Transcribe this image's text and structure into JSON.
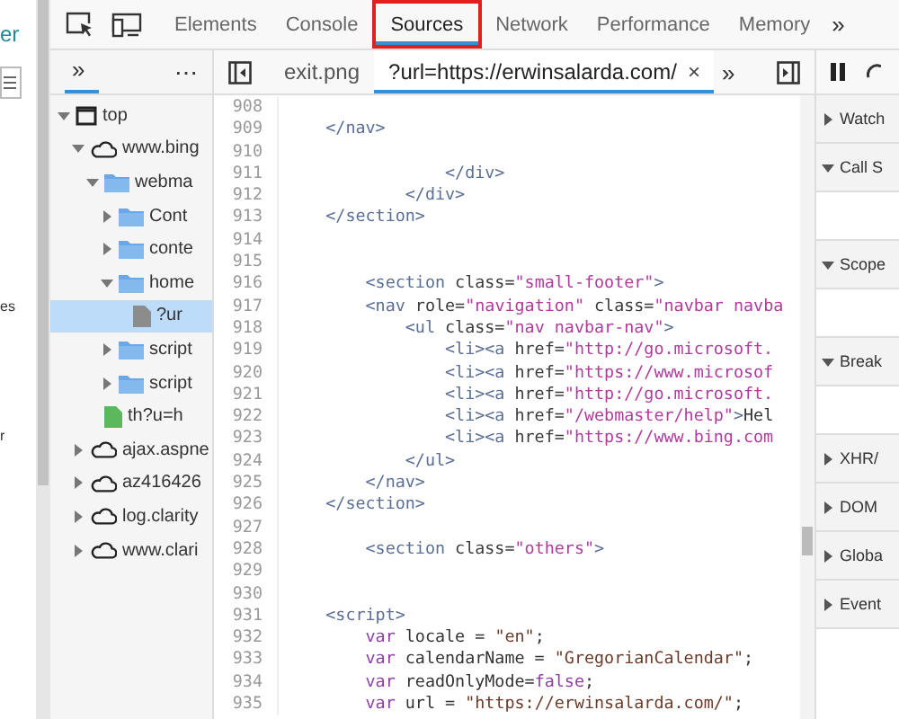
{
  "page_fragment": {
    "texts": [
      "er",
      "es",
      "r"
    ]
  },
  "toolbar": {
    "tabs": [
      {
        "label": "Elements",
        "selected": false,
        "highlighted": false
      },
      {
        "label": "Console",
        "selected": false,
        "highlighted": false
      },
      {
        "label": "Sources",
        "selected": true,
        "highlighted": true
      },
      {
        "label": "Network",
        "selected": false,
        "highlighted": false
      },
      {
        "label": "Performance",
        "selected": false,
        "highlighted": false
      },
      {
        "label": "Memory",
        "selected": false,
        "highlighted": false
      }
    ],
    "overflow": "»"
  },
  "navigator": {
    "tabs": [
      {
        "label": "»",
        "selected": true
      }
    ],
    "menu": "⋯",
    "tree": [
      {
        "kind": "frame",
        "name": "top",
        "expanded": true,
        "selected": false,
        "children": [
          {
            "kind": "domain",
            "name": "www.bing",
            "expanded": true,
            "selected": false,
            "children": [
              {
                "kind": "folder",
                "name": "webma",
                "expanded": true,
                "selected": false,
                "children": [
                  {
                    "kind": "folder",
                    "name": "Cont",
                    "expanded": false,
                    "selected": false
                  },
                  {
                    "kind": "folder",
                    "name": "conte",
                    "expanded": false,
                    "selected": false
                  },
                  {
                    "kind": "folder",
                    "name": "home",
                    "expanded": true,
                    "selected": false,
                    "children": [
                      {
                        "kind": "file",
                        "name": "?ur",
                        "selected": true
                      }
                    ]
                  },
                  {
                    "kind": "folder",
                    "name": "script",
                    "expanded": false,
                    "selected": false
                  },
                  {
                    "kind": "folder",
                    "name": "script",
                    "expanded": false,
                    "selected": false
                  }
                ]
              },
              {
                "kind": "resource",
                "name": "th?u=h",
                "selected": false
              }
            ]
          },
          {
            "kind": "domain",
            "name": "ajax.aspne",
            "expanded": false,
            "selected": false
          },
          {
            "kind": "domain",
            "name": "az416426",
            "expanded": false,
            "selected": false
          },
          {
            "kind": "domain",
            "name": "log.clarity",
            "expanded": false,
            "selected": false
          },
          {
            "kind": "domain",
            "name": "www.clari",
            "expanded": false,
            "selected": false
          }
        ]
      }
    ]
  },
  "editor": {
    "tabs": [
      {
        "label": "exit.png",
        "selected": false,
        "closable": false
      },
      {
        "label": "?url=https://erwinsalarda.com/",
        "selected": true,
        "closable": true
      }
    ],
    "close": "×",
    "overflow": "»",
    "lines": [
      {
        "number": "908"
      },
      {
        "number": "909",
        "tokens": [
          {
            "kind": "tag",
            "text": "    </nav>"
          }
        ]
      },
      {
        "number": "910"
      },
      {
        "number": "911",
        "tokens": [
          {
            "kind": "tag",
            "text": "                </div>"
          }
        ]
      },
      {
        "number": "912",
        "tokens": [
          {
            "kind": "tag",
            "text": "            </div>"
          }
        ]
      },
      {
        "number": "913",
        "tokens": [
          {
            "kind": "tag",
            "text": "    </section>"
          }
        ]
      },
      {
        "number": "914"
      },
      {
        "number": "915"
      },
      {
        "number": "916",
        "tokens": [
          {
            "kind": "tag",
            "text": "        <section "
          },
          {
            "kind": "attr",
            "text": "class="
          },
          {
            "kind": "value",
            "text": "\"small-footer\""
          },
          {
            "kind": "tag",
            "text": ">"
          }
        ]
      },
      {
        "number": "917",
        "tokens": [
          {
            "kind": "tag",
            "text": "        <nav "
          },
          {
            "kind": "attr",
            "text": "role="
          },
          {
            "kind": "value",
            "text": "\"navigation\""
          },
          {
            "kind": "attr",
            "text": " class="
          },
          {
            "kind": "value",
            "text": "\"navbar navba"
          }
        ]
      },
      {
        "number": "918",
        "tokens": [
          {
            "kind": "tag",
            "text": "            <ul "
          },
          {
            "kind": "attr",
            "text": "class="
          },
          {
            "kind": "value",
            "text": "\"nav navbar-nav\""
          },
          {
            "kind": "tag",
            "text": ">"
          }
        ]
      },
      {
        "number": "919",
        "tokens": [
          {
            "kind": "tag",
            "text": "                <li><a "
          },
          {
            "kind": "attr",
            "text": "href="
          },
          {
            "kind": "value",
            "text": "\"http://go.microsoft."
          }
        ]
      },
      {
        "number": "920",
        "tokens": [
          {
            "kind": "tag",
            "text": "                <li><a "
          },
          {
            "kind": "attr",
            "text": "href="
          },
          {
            "kind": "value",
            "text": "\"https://www.microsof"
          }
        ]
      },
      {
        "number": "921",
        "tokens": [
          {
            "kind": "tag",
            "text": "                <li><a "
          },
          {
            "kind": "attr",
            "text": "href="
          },
          {
            "kind": "value",
            "text": "\"http://go.microsoft."
          }
        ]
      },
      {
        "number": "922",
        "tokens": [
          {
            "kind": "tag",
            "text": "                <li><a "
          },
          {
            "kind": "attr",
            "text": "href="
          },
          {
            "kind": "value",
            "text": "\"/webmaster/help\""
          },
          {
            "kind": "tag",
            "text": ">"
          },
          {
            "kind": "plain",
            "text": "Hel"
          }
        ]
      },
      {
        "number": "923",
        "tokens": [
          {
            "kind": "tag",
            "text": "                <li><a "
          },
          {
            "kind": "attr",
            "text": "href="
          },
          {
            "kind": "value",
            "text": "\"https://www.bing.com"
          }
        ]
      },
      {
        "number": "924",
        "tokens": [
          {
            "kind": "tag",
            "text": "            </ul>"
          }
        ]
      },
      {
        "number": "925",
        "tokens": [
          {
            "kind": "tag",
            "text": "        </nav>"
          }
        ]
      },
      {
        "number": "926",
        "tokens": [
          {
            "kind": "tag",
            "text": "    </section>"
          }
        ]
      },
      {
        "number": "927"
      },
      {
        "number": "928",
        "tokens": [
          {
            "kind": "tag",
            "text": "        <section "
          },
          {
            "kind": "attr",
            "text": "class="
          },
          {
            "kind": "value",
            "text": "\"others\""
          },
          {
            "kind": "tag",
            "text": ">"
          }
        ]
      },
      {
        "number": "929"
      },
      {
        "number": "930"
      },
      {
        "number": "931",
        "tokens": [
          {
            "kind": "tag",
            "text": "    <script>"
          }
        ]
      },
      {
        "number": "932",
        "tokens": [
          {
            "kind": "keyword",
            "text": "        var "
          },
          {
            "kind": "plain",
            "text": "locale = "
          },
          {
            "kind": "string",
            "text": "\"en\""
          },
          {
            "kind": "plain",
            "text": ";"
          }
        ]
      },
      {
        "number": "933",
        "tokens": [
          {
            "kind": "keyword",
            "text": "        var "
          },
          {
            "kind": "plain",
            "text": "calendarName = "
          },
          {
            "kind": "string",
            "text": "\"GregorianCalendar\""
          },
          {
            "kind": "plain",
            "text": ";"
          }
        ]
      },
      {
        "number": "934",
        "tokens": [
          {
            "kind": "keyword",
            "text": "        var "
          },
          {
            "kind": "plain",
            "text": "readOnlyMode="
          },
          {
            "kind": "keyword",
            "text": "false"
          },
          {
            "kind": "plain",
            "text": ";"
          }
        ]
      },
      {
        "number": "935",
        "tokens": [
          {
            "kind": "keyword",
            "text": "        var "
          },
          {
            "kind": "plain",
            "text": "url = "
          },
          {
            "kind": "string",
            "text": "\"https://erwinsalarda.com/\""
          },
          {
            "kind": "plain",
            "text": ";"
          }
        ]
      }
    ]
  },
  "debugger": {
    "sections": [
      {
        "title": "Watch",
        "expanded": false
      },
      {
        "title": "Call S",
        "expanded": true
      },
      {
        "title": "Scope",
        "expanded": true
      },
      {
        "title": "Break",
        "expanded": true
      },
      {
        "title": "XHR/",
        "expanded": false
      },
      {
        "title": "DOM",
        "expanded": false
      },
      {
        "title": "Globa",
        "expanded": false
      },
      {
        "title": "Event",
        "expanded": false
      }
    ]
  }
}
